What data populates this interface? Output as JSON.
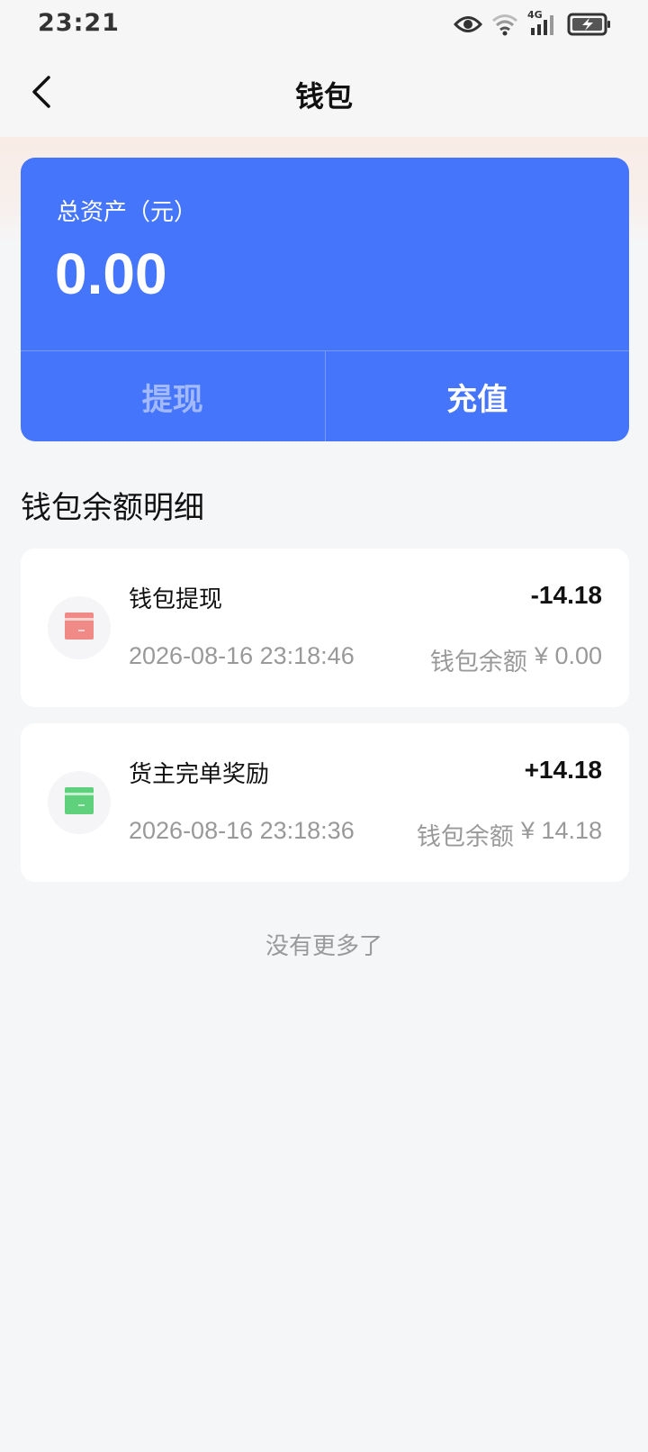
{
  "status_bar": {
    "time": "23:21",
    "network": "4G"
  },
  "nav": {
    "title": "钱包"
  },
  "asset_card": {
    "label": "总资产（元）",
    "value": "0.00",
    "withdraw_label": "提现",
    "recharge_label": "充值"
  },
  "section": {
    "title": "钱包余额明细"
  },
  "transactions": [
    {
      "title": "钱包提现",
      "amount": "-14.18",
      "time": "2026-08-16 23:18:46",
      "balance_label": "钱包余额",
      "balance_value": "¥ 0.00",
      "icon": "card-out-icon",
      "icon_color": "#f08a86"
    },
    {
      "title": "货主完单奖励",
      "amount": "+14.18",
      "time": "2026-08-16 23:18:36",
      "balance_label": "钱包余额",
      "balance_value": "¥ 14.18",
      "icon": "card-in-icon",
      "icon_color": "#5fd07b"
    }
  ],
  "footer": {
    "no_more": "没有更多了"
  },
  "colors": {
    "primary_blue": "#4575fa",
    "page_bg": "#f5f6f8"
  }
}
